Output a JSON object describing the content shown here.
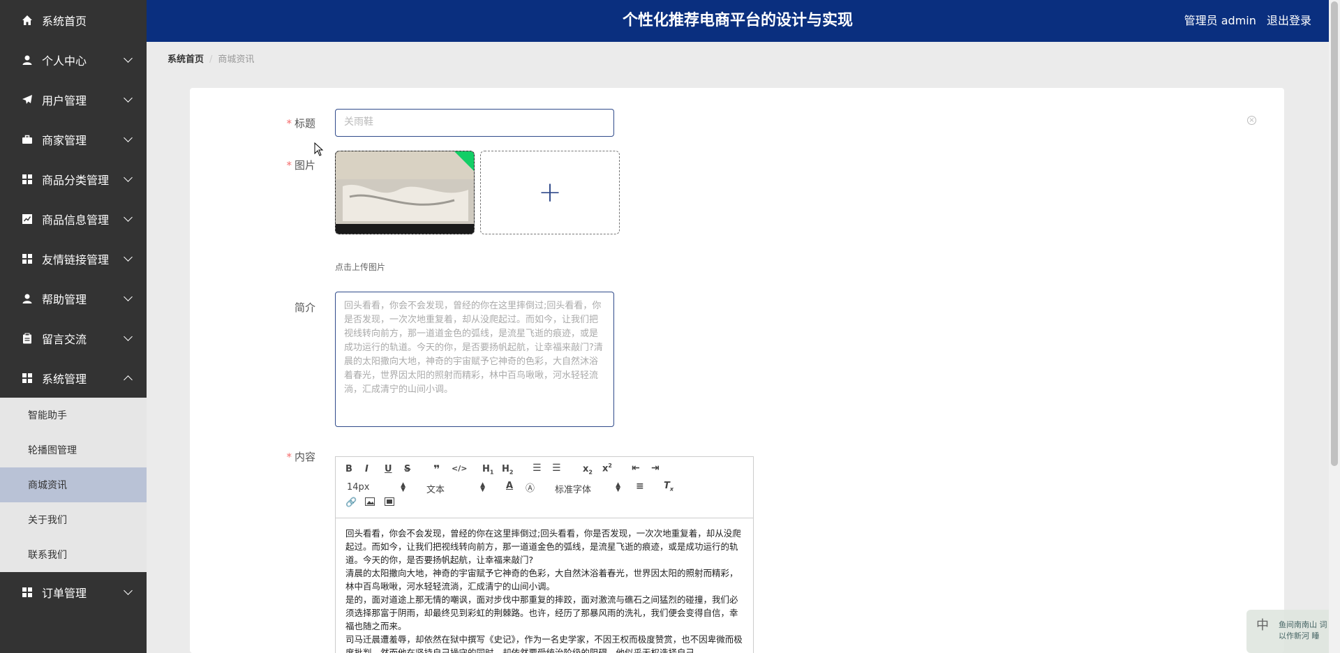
{
  "sidebar": {
    "items": [
      {
        "label": "系统首页",
        "icon": "home-icon",
        "expandable": false
      },
      {
        "label": "个人中心",
        "icon": "user-icon",
        "expandable": true
      },
      {
        "label": "用户管理",
        "icon": "paper-plane-icon",
        "expandable": true
      },
      {
        "label": "商家管理",
        "icon": "briefcase-icon",
        "expandable": true
      },
      {
        "label": "商品分类管理",
        "icon": "grid-icon",
        "expandable": true
      },
      {
        "label": "商品信息管理",
        "icon": "chart-icon",
        "expandable": true
      },
      {
        "label": "友情链接管理",
        "icon": "grid-icon",
        "expandable": true
      },
      {
        "label": "帮助管理",
        "icon": "user-icon",
        "expandable": true
      },
      {
        "label": "留言交流",
        "icon": "clipboard-icon",
        "expandable": true
      },
      {
        "label": "系统管理",
        "icon": "grid-icon",
        "expandable": true,
        "expanded": true
      }
    ],
    "submenu": [
      {
        "label": "智能助手"
      },
      {
        "label": "轮播图管理"
      },
      {
        "label": "商城资讯",
        "active": true
      },
      {
        "label": "关于我们"
      },
      {
        "label": "联系我们"
      }
    ],
    "bottom_item": {
      "label": "订单管理",
      "icon": "grid-icon"
    }
  },
  "header": {
    "title": "个性化推荐电商平台的设计与实现",
    "user_label": "管理员 admin",
    "logout": "退出登录",
    "bg_color": "#0a2f7f"
  },
  "breadcrumb": {
    "home": "系统首页",
    "current": "商城资讯"
  },
  "form": {
    "title_label": "标题",
    "title_value": "关雨鞋",
    "image_label": "图片",
    "upload_tip": "点击上传图片",
    "intro_label": "简介",
    "intro_value": "回头看看，你会不会发现，曾经的你在这里摔倒过;回头看看，你是否发现，一次次地重复着，却从没爬起过。而如今，让我们把视线转向前方，那一道道金色的弧线，是流星飞逝的痕迹，或是成功运行的轨道。今天的你，是否要扬帆起航，让幸福来敲门?清晨的太阳撒向大地，神奇的宇宙赋予它神奇的色彩，大自然沐浴着春光，世界因太阳的照射而精彩，林中百鸟啾啾，河水轻轻流淌，汇成清宁的山间小调。",
    "content_label": "内容"
  },
  "editor": {
    "font_size": "14px",
    "block_type": "文本",
    "font_family": "标准字体",
    "paragraphs": [
      "回头看看，你会不会发现，曾经的你在这里摔倒过;回头看看，你是否发现，一次次地重复着，却从没爬起过。而如今，让我们把视线转向前方，那一道道金色的弧线，是流星飞逝的痕迹，或是成功运行的轨道。今天的你，是否要扬帆起航，让幸福来敲门?",
      "清晨的太阳撒向大地，神奇的宇宙赋予它神奇的色彩，大自然沐浴着春光，世界因太阳的照射而精彩，林中百鸟啾啾，河水轻轻流淌，汇成清宁的山间小调。",
      "是的，面对道途上那无情的嘲讽，面对步伐中那重复的摔跤，面对激流与礁石之间猛烈的碰撞，我们必须选择那富于阴雨，却最终见到彩虹的荆棘路。也许，经历了那暴风雨的洗礼，我们便会变得自信，幸福也随之而来。",
      "司马迁晨遭羞辱，却依然在狱中撰写《史记》，作为一名史学家，不因王权而极度赞赏，也不因卑微而极度批判，然而他在坚持自己操守的同时，却依然要受统治阶级的阻碍，他似乎无权选择自己"
    ]
  },
  "ime": {
    "lang": "中",
    "text_line1": "鱼间南南山 词",
    "text_line2": "以作新河 睡"
  }
}
